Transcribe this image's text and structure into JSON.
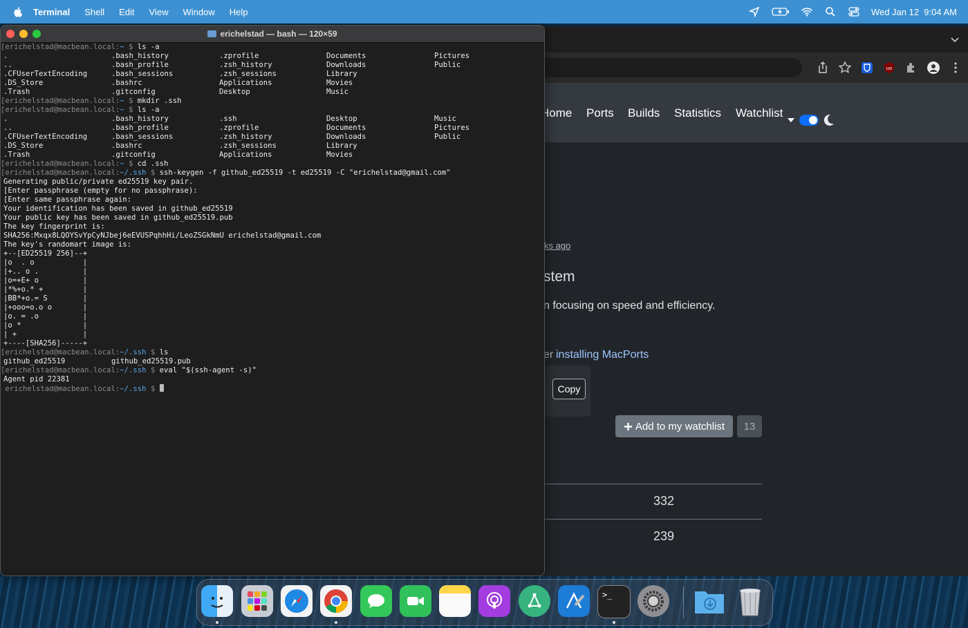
{
  "menubar": {
    "app_name": "Terminal",
    "menus": [
      "Shell",
      "Edit",
      "View",
      "Window",
      "Help"
    ],
    "clock": "Wed Jan 12  9:04 AM",
    "status_icons": [
      "location-icon",
      "battery-icon",
      "wifi-icon",
      "search-icon",
      "control-center-icon"
    ]
  },
  "terminal": {
    "title": "erichelstad — bash — 120×59",
    "lines": [
      {
        "type": "prompt",
        "host": "[erichelstad@macbean.local:",
        "path": "~",
        "cmd": "ls -a"
      },
      {
        "type": "cols",
        "cells": [
          ".",
          ".bash_history",
          ".zprofile",
          "Documents",
          "Pictures"
        ]
      },
      {
        "type": "cols",
        "cells": [
          "..",
          ".bash_profile",
          ".zsh_history",
          "Downloads",
          "Public"
        ]
      },
      {
        "type": "cols",
        "cells": [
          ".CFUserTextEncoding",
          ".bash_sessions",
          ".zsh_sessions",
          "Library",
          ""
        ]
      },
      {
        "type": "cols",
        "cells": [
          ".DS_Store",
          ".bashrc",
          "Applications",
          "Movies",
          ""
        ]
      },
      {
        "type": "cols",
        "cells": [
          ".Trash",
          ".gitconfig",
          "Desktop",
          "Music",
          ""
        ]
      },
      {
        "type": "prompt",
        "host": "[erichelstad@macbean.local:",
        "path": "~",
        "cmd": "mkdir .ssh"
      },
      {
        "type": "prompt",
        "host": "[erichelstad@macbean.local:",
        "path": "~",
        "cmd": "ls -a"
      },
      {
        "type": "cols",
        "cells": [
          ".",
          ".bash_history",
          ".ssh",
          "Desktop",
          "Music"
        ]
      },
      {
        "type": "cols",
        "cells": [
          "..",
          ".bash_profile",
          ".zprofile",
          "Documents",
          "Pictures"
        ]
      },
      {
        "type": "cols",
        "cells": [
          ".CFUserTextEncoding",
          ".bash_sessions",
          ".zsh_history",
          "Downloads",
          "Public"
        ]
      },
      {
        "type": "cols",
        "cells": [
          ".DS_Store",
          ".bashrc",
          ".zsh_sessions",
          "Library",
          ""
        ]
      },
      {
        "type": "cols",
        "cells": [
          ".Trash",
          ".gitconfig",
          "Applications",
          "Movies",
          ""
        ]
      },
      {
        "type": "prompt",
        "host": "[erichelstad@macbean.local:",
        "path": "~",
        "cmd": "cd .ssh"
      },
      {
        "type": "prompt",
        "host": "[erichelstad@macbean.local:",
        "path": "~/.ssh",
        "cmd": "ssh-keygen -f github_ed25519 -t ed25519 -C \"erichelstad@gmail.com\""
      },
      {
        "type": "text",
        "text": "Generating public/private ed25519 key pair."
      },
      {
        "type": "text",
        "text": "[Enter passphrase (empty for no passphrase):"
      },
      {
        "type": "text",
        "text": "[Enter same passphrase again:"
      },
      {
        "type": "text",
        "text": "Your identification has been saved in github_ed25519"
      },
      {
        "type": "text",
        "text": "Your public key has been saved in github_ed25519.pub"
      },
      {
        "type": "text",
        "text": "The key fingerprint is:"
      },
      {
        "type": "text",
        "text": "SHA256:Mxqx8LQOYSvYpCyNJbej6eEVUSPqhhHi/LeoZSGkNmU erichelstad@gmail.com"
      },
      {
        "type": "text",
        "text": "The key's randomart image is:"
      },
      {
        "type": "text",
        "text": "+--[ED25519 256]--+"
      },
      {
        "type": "text",
        "text": "|o  . o           |"
      },
      {
        "type": "text",
        "text": "|+.. o .          |"
      },
      {
        "type": "text",
        "text": "|o=+E+ o          |"
      },
      {
        "type": "text",
        "text": "|*%+o.* +         |"
      },
      {
        "type": "text",
        "text": "|BB*+o.= S        |"
      },
      {
        "type": "text",
        "text": "|+ooo=o.o o       |"
      },
      {
        "type": "text",
        "text": "|o. = .o          |"
      },
      {
        "type": "text",
        "text": "|o *              |"
      },
      {
        "type": "text",
        "text": "| +               |"
      },
      {
        "type": "text",
        "text": "+----[SHA256]-----+"
      },
      {
        "type": "prompt",
        "host": "[erichelstad@macbean.local:",
        "path": "~/.ssh",
        "cmd": "ls"
      },
      {
        "type": "cols",
        "cells": [
          "github_ed25519",
          "github_ed25519.pub",
          "",
          "",
          ""
        ]
      },
      {
        "type": "prompt",
        "host": "[erichelstad@macbean.local:",
        "path": "~/.ssh",
        "cmd": "eval \"$(ssh-agent -s)\""
      },
      {
        "type": "text",
        "text": "Agent pid 22381"
      },
      {
        "type": "prompt",
        "host": " erichelstad@macbean.local:",
        "path": "~/.ssh",
        "cmd": "",
        "cursor": true
      }
    ]
  },
  "browser": {
    "nav": [
      "Home",
      "Ports",
      "Builds",
      "Statistics",
      "Watchlist"
    ],
    "time_ago": "ks ago",
    "heading": "stem",
    "description": "n focusing on speed and efficiency.",
    "install_prefix": "er",
    "install_link": "installing MacPorts",
    "copy_label": "Copy",
    "watchlist_button": "Add to my watchlist",
    "watchlist_count": "13",
    "stat1": "332",
    "stat2": "239"
  },
  "dock": {
    "apps": [
      "finder-icon",
      "launchpad-icon",
      "safari-icon",
      "chrome-icon",
      "messages-icon",
      "facetime-icon",
      "notes-icon",
      "podcasts-icon",
      "git-app-icon",
      "xcode-icon",
      "terminal-icon",
      "system-preferences-icon",
      "downloads-folder-icon",
      "trash-icon"
    ]
  },
  "colors": {
    "menubar": "#3d91d2",
    "terminal_bg": "#1e1e1e",
    "path": "#5ba7e6",
    "browser_bg": "#212529",
    "nav": "#343a40"
  }
}
